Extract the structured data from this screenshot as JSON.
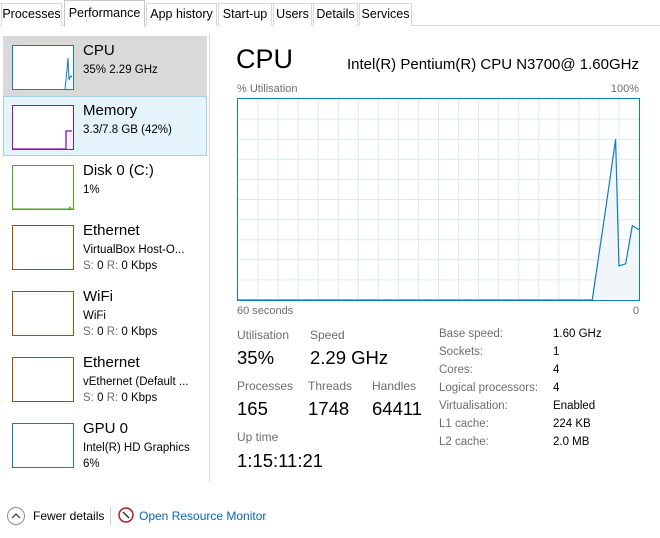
{
  "tabs": [
    {
      "label": "Processes"
    },
    {
      "label": "Performance"
    },
    {
      "label": "App history"
    },
    {
      "label": "Start-up"
    },
    {
      "label": "Users"
    },
    {
      "label": "Details"
    },
    {
      "label": "Services"
    }
  ],
  "sidebar": {
    "items": [
      {
        "title": "CPU",
        "sub1": "35%  2.29 GHz",
        "sub2": "",
        "color": "#117dbb"
      },
      {
        "title": "Memory",
        "sub1": "3.3/7.8 GB (42%)",
        "sub2": "",
        "color": "#8b12ae"
      },
      {
        "title": "Disk 0 (C:)",
        "sub1": "1%",
        "sub2": "",
        "color": "#4da60c"
      },
      {
        "title": "Ethernet",
        "sub1": "VirtualBox Host-O...",
        "s_label": "S:",
        "s_value": "0",
        "r_label": "R:",
        "r_value": "0 Kbps",
        "color": "#a74f01"
      },
      {
        "title": "WiFi",
        "sub1": "WiFi",
        "s_label": "S:",
        "s_value": "0",
        "r_label": "R:",
        "r_value": "0 Kbps",
        "color": "#a74f01"
      },
      {
        "title": "Ethernet",
        "sub1": "vEthernet (Default ...",
        "s_label": "S:",
        "s_value": "0",
        "r_label": "R:",
        "r_value": "0 Kbps",
        "color": "#a74f01"
      },
      {
        "title": "GPU 0",
        "sub1": "Intel(R) HD Graphics",
        "sub2": "6%",
        "color": "#117dbb"
      }
    ]
  },
  "main": {
    "title": "CPU",
    "model": "Intel(R) Pentium(R) CPU N3700@ 1.60GHz",
    "util_label": "% Utilisation",
    "util_max": "100%",
    "axis_left": "60 seconds",
    "axis_right": "0",
    "stats": {
      "utilisation_label": "Utilisation",
      "utilisation": "35%",
      "speed_label": "Speed",
      "speed": "2.29 GHz",
      "processes_label": "Processes",
      "processes": "165",
      "threads_label": "Threads",
      "threads": "1748",
      "handles_label": "Handles",
      "handles": "64411",
      "uptime_label": "Up time",
      "uptime": "1:15:11:21"
    },
    "specs": [
      {
        "label": "Base speed:",
        "value": "1.60 GHz"
      },
      {
        "label": "Sockets:",
        "value": "1"
      },
      {
        "label": "Cores:",
        "value": "4"
      },
      {
        "label": "Logical processors:",
        "value": "4"
      },
      {
        "label": "Virtualisation:",
        "value": "Enabled"
      },
      {
        "label": "L1 cache:",
        "value": "224 KB"
      },
      {
        "label": "L2 cache:",
        "value": "2.0 MB"
      }
    ]
  },
  "footer": {
    "fewer_details": "Fewer details",
    "open_resource_monitor": "Open Resource Monitor"
  },
  "chart_data": {
    "type": "area",
    "y_range": [
      0,
      100
    ],
    "x_range_seconds": [
      60,
      0
    ],
    "grid": true,
    "x": [
      60,
      7,
      5,
      3.5,
      3,
      2,
      1,
      0
    ],
    "values": [
      0,
      0,
      45,
      80,
      17,
      18,
      37,
      35
    ]
  }
}
